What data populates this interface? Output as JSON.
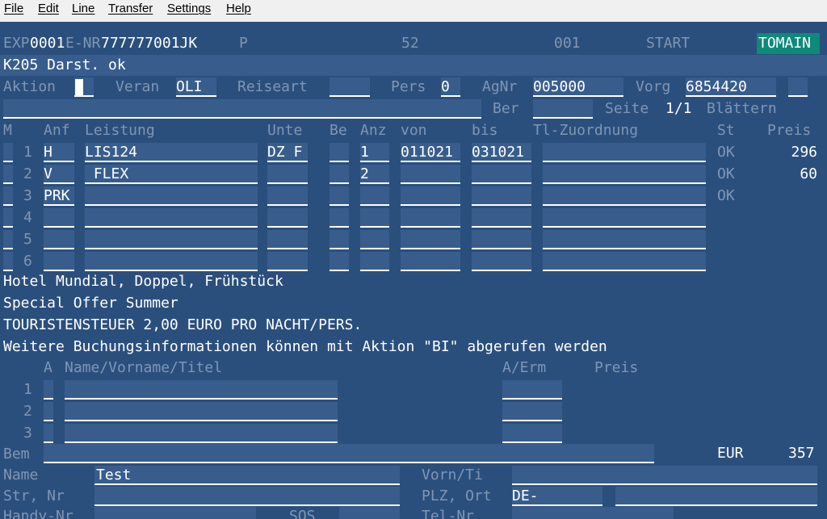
{
  "menu": [
    "File",
    "Edit",
    "Line",
    "Transfer",
    "Settings",
    "Help"
  ],
  "header": {
    "exp_label": "EXP",
    "exp_value": "0001",
    "enr_label": "E-NR",
    "enr_value": "777777001JK",
    "p_label": "P",
    "num1": "52",
    "num2": "001",
    "start": "START",
    "tomain": "TOMAIN"
  },
  "status_message": "K205 Darst. ok",
  "row3": {
    "aktion_label": "Aktion",
    "veran_label": "Veran",
    "veran_value": "OLI",
    "reiseart_label": "Reiseart",
    "pers_label": "Pers",
    "pers_value": "0",
    "agnr_label": "AgNr",
    "agnr_value": "005000",
    "vorg_label": "Vorg",
    "vorg_value": "6854420"
  },
  "row4": {
    "ber_label": "Ber",
    "seite_label": "Seite",
    "seite_value": "1/1",
    "blaettern": "Blättern"
  },
  "table_headers": {
    "m": "M",
    "anf": "Anf",
    "leistung": "Leistung",
    "unte": "Unte",
    "be": "Be",
    "anz": "Anz",
    "von": "von",
    "bis": "bis",
    "tl": "Tl-Zuordnung",
    "st": "St",
    "preis": "Preis"
  },
  "rows": [
    {
      "num": "1",
      "anf": "H",
      "leistung": "LIS124",
      "unte": "DZ F",
      "anz": "1",
      "von": "011021",
      "bis": "031021",
      "st": "OK",
      "preis": "296"
    },
    {
      "num": "2",
      "anf": "V",
      "leistung": " FLEX",
      "unte": "",
      "anz": "2",
      "von": "",
      "bis": "",
      "st": "OK",
      "preis": "60"
    },
    {
      "num": "3",
      "anf": "PRK",
      "leistung": "",
      "unte": "",
      "anz": "",
      "von": "",
      "bis": "",
      "st": "OK",
      "preis": ""
    },
    {
      "num": "4",
      "anf": "",
      "leistung": "",
      "unte": "",
      "anz": "",
      "von": "",
      "bis": "",
      "st": "",
      "preis": ""
    },
    {
      "num": "5",
      "anf": "",
      "leistung": "",
      "unte": "",
      "anz": "",
      "von": "",
      "bis": "",
      "st": "",
      "preis": ""
    },
    {
      "num": "6",
      "anf": "",
      "leistung": "",
      "unte": "",
      "anz": "",
      "von": "",
      "bis": "",
      "st": "",
      "preis": ""
    }
  ],
  "info_lines": [
    "Hotel Mundial, Doppel, Frühstück",
    "Special Offer Summer",
    "TOURISTENSTEUER 2,00 EURO PRO NACHT/PERS.",
    "Weitere Buchungsinformationen können mit Aktion \"BI\" abgerufen werden"
  ],
  "persons_headers": {
    "a": "A",
    "name": "Name/Vorname/Titel",
    "aerm": "A/Erm",
    "preis": "Preis"
  },
  "person_rows": [
    "1",
    "2",
    "3"
  ],
  "bem_label": "Bem",
  "total": {
    "currency": "EUR",
    "amount": "357"
  },
  "customer": {
    "name_label": "Name",
    "name_value": "Test",
    "vorn_label": "Vorn/Ti",
    "str_label": "Str, Nr",
    "plz_label": "PLZ, Ort",
    "plz_value": "DE-",
    "handy_label": "Handy-Nr",
    "sos_label": "SOS",
    "tel_label": "Tel-Nr"
  }
}
